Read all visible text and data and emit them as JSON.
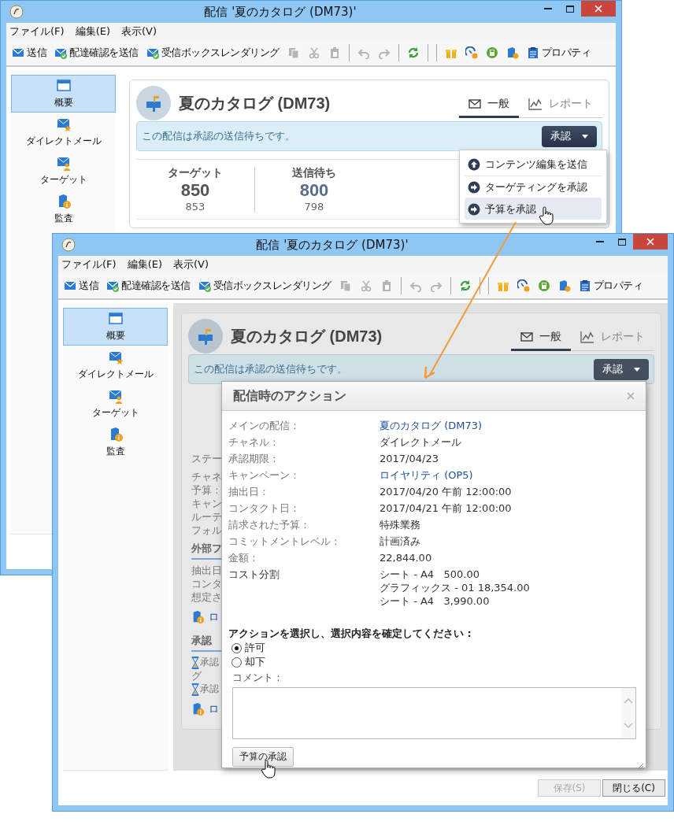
{
  "back_window": {
    "title": "配信 '夏のカタログ (DM73)'",
    "menu": [
      "ファイル(F)",
      "編集(E)",
      "表示(V)"
    ],
    "toolbar": [
      {
        "kind": "send",
        "label": "送信"
      },
      {
        "kind": "proof",
        "label": "配達確認を送信"
      },
      {
        "kind": "inbox",
        "label": "受信ボックスレンダリング"
      },
      {
        "kind": "copy",
        "disabled": true
      },
      {
        "kind": "cut",
        "disabled": true
      },
      {
        "kind": "paste",
        "disabled": true
      },
      {
        "kind": "separator"
      },
      {
        "kind": "undo",
        "disabled": true
      },
      {
        "kind": "redo",
        "disabled": true
      },
      {
        "kind": "separator"
      },
      {
        "kind": "refresh",
        "disabled": false
      },
      {
        "kind": "separator"
      },
      {
        "kind": "separator"
      },
      {
        "kind": "gift",
        "disabled": false
      },
      {
        "kind": "gauge",
        "disabled": false
      },
      {
        "kind": "calculator",
        "disabled": false
      },
      {
        "kind": "tag",
        "disabled": false
      },
      {
        "kind": "properties",
        "label": "プロパティ"
      }
    ],
    "sidebar": [
      {
        "kind": "overview",
        "label": "概要",
        "selected": true
      },
      {
        "kind": "mail",
        "label": "ダイレクトメール",
        "selected": false
      },
      {
        "kind": "target",
        "label": "ターゲット",
        "selected": false
      },
      {
        "kind": "audit",
        "label": "監査",
        "selected": false
      }
    ],
    "card": {
      "title": "夏のカタログ (DM73)",
      "tabs": [
        {
          "kind": "general",
          "label": "一般",
          "selected": true
        },
        {
          "kind": "report",
          "label": "レポート",
          "selected": false
        }
      ],
      "banner": "この配信は承認の送信待ちです。",
      "approve_button": "承認",
      "stats": [
        {
          "label": "ターゲット",
          "value": "850",
          "sub": "853",
          "color": "#555555"
        },
        {
          "label": "送信待ち",
          "value": "800",
          "sub": "798",
          "color": "#5a6e8c"
        }
      ]
    },
    "popup": [
      {
        "kind": "up",
        "label": "コンテンツ編集を送信",
        "selected": false
      },
      {
        "kind": "right",
        "label": "ターゲティングを承認",
        "selected": false
      },
      {
        "kind": "right",
        "label": "予算を承認",
        "selected": true
      }
    ]
  },
  "front_window": {
    "title": "配信 '夏のカタログ (DM73)'",
    "menu": [
      "ファイル(F)",
      "編集(E)",
      "表示(V)"
    ],
    "toolbar": [
      {
        "kind": "send",
        "label": "送信"
      },
      {
        "kind": "proof",
        "label": "配達確認を送信"
      },
      {
        "kind": "inbox",
        "label": "受信ボックスレンダリング"
      },
      {
        "kind": "copy",
        "disabled": true
      },
      {
        "kind": "cut",
        "disabled": true
      },
      {
        "kind": "paste",
        "disabled": true
      },
      {
        "kind": "separator"
      },
      {
        "kind": "undo",
        "disabled": true
      },
      {
        "kind": "redo",
        "disabled": true
      },
      {
        "kind": "separator"
      },
      {
        "kind": "refresh",
        "disabled": false
      },
      {
        "kind": "separator"
      },
      {
        "kind": "separator"
      },
      {
        "kind": "gift",
        "disabled": false
      },
      {
        "kind": "gauge",
        "disabled": false
      },
      {
        "kind": "calculator",
        "disabled": false
      },
      {
        "kind": "tag",
        "disabled": false
      },
      {
        "kind": "properties",
        "label": "プロパティ"
      }
    ],
    "sidebar": [
      {
        "kind": "overview",
        "label": "概要",
        "selected": true
      },
      {
        "kind": "mail",
        "label": "ダイレクトメール",
        "selected": false
      },
      {
        "kind": "target",
        "label": "ターゲット",
        "selected": false
      },
      {
        "kind": "audit",
        "label": "監査",
        "selected": false
      }
    ],
    "card": {
      "title": "夏のカタログ (DM73)",
      "tabs": [
        {
          "kind": "general",
          "label": "一般",
          "selected": true
        },
        {
          "kind": "report",
          "label": "レポート",
          "selected": false
        }
      ],
      "banner": "この配信は承認の送信待ちです。",
      "approve_button": "承認",
      "fragments": [
        {
          "kind": "first",
          "label": "ステー"
        },
        {
          "kind": "text",
          "label": "チャネ"
        },
        {
          "kind": "text",
          "label": "予算 :"
        },
        {
          "kind": "text",
          "label": "キャン"
        },
        {
          "kind": "text",
          "label": "ルーテ"
        },
        {
          "kind": "text",
          "label": "フォル"
        },
        {
          "kind": "heading",
          "label": "外部フ"
        },
        {
          "kind": "text",
          "label": "抽出日"
        },
        {
          "kind": "text",
          "label": "コンタ"
        },
        {
          "kind": "text",
          "label": "想定さ"
        },
        {
          "kind": "log",
          "label": "ロ"
        },
        {
          "kind": "heading",
          "label": "承認"
        },
        {
          "kind": "pending",
          "label": "承認"
        },
        {
          "kind": "text",
          "label": "グ"
        },
        {
          "kind": "pending",
          "label": "承認"
        },
        {
          "kind": "log",
          "label": "ロ"
        }
      ]
    },
    "dialog": {
      "title": "配信時のアクション",
      "rows": [
        {
          "kind": "link",
          "label": "メインの配信 :",
          "value": "夏のカタログ (DM73)"
        },
        {
          "kind": "text",
          "label": "チャネル :",
          "value": "ダイレクトメール"
        },
        {
          "kind": "text",
          "label": "承認期限 :",
          "value": "2017/04/23"
        },
        {
          "kind": "link",
          "label": "キャンペーン :",
          "value": "ロイヤリティ (OP5)"
        },
        {
          "kind": "text",
          "label": "抽出日 :",
          "value": "2017/04/20 午前 12:00:00"
        },
        {
          "kind": "text",
          "label": "コンタクト日 :",
          "value": "2017/04/21 午前 12:00:00"
        },
        {
          "kind": "text",
          "label": "請求された予算 :",
          "value": "特殊業務"
        },
        {
          "kind": "text",
          "label": "コミットメントレベル :",
          "value": "計画済み"
        },
        {
          "kind": "text",
          "label": "金額 :",
          "value": "22,844.00"
        },
        {
          "kind": "lines",
          "label": "コスト分割",
          "lines": [
            "シート - A4   500.00",
            "グラフィックス - 01 18,354.00",
            "シート - A4   3,990.00"
          ]
        }
      ],
      "prompt": "アクションを選択し、選択内容を確定してください :",
      "options": [
        {
          "label": "許可",
          "selected": true
        },
        {
          "label": "却下",
          "selected": false
        }
      ],
      "comment_label": "コメント :",
      "confirm_button": "予算の承認"
    },
    "footer": [
      {
        "label": "保存(S)",
        "disabled": true
      },
      {
        "label": "閉じる(C)",
        "disabled": false
      }
    ]
  }
}
